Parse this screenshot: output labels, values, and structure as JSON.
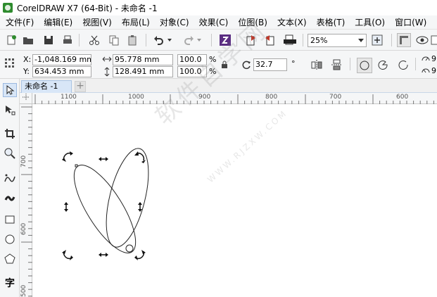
{
  "window": {
    "title": "CorelDRAW X7 (64-Bit) - 未命名 -1"
  },
  "menu": [
    "文件(F)",
    "编辑(E)",
    "视图(V)",
    "布局(L)",
    "对象(C)",
    "效果(C)",
    "位图(B)",
    "文本(X)",
    "表格(T)",
    "工具(O)",
    "窗口(W)"
  ],
  "toolbar": {
    "zoom_value": "25%",
    "icons": [
      "new-icon",
      "open-icon",
      "save-icon",
      "print-icon",
      "cut-icon",
      "copy-icon",
      "paste-icon",
      "undo-icon",
      "redo-icon",
      "search-content-icon",
      "import-icon",
      "export-icon",
      "publish-pdf-icon",
      "full-screen-icon",
      "show-rulers-icon",
      "view-icon"
    ]
  },
  "property_bar": {
    "x_label": "X:",
    "x_value": "-1,048.169 mm",
    "y_label": "Y:",
    "y_value": "634.453 mm",
    "width_value": "95.778 mm",
    "height_value": "128.491 mm",
    "scale_x": "100.0",
    "scale_y": "100.0",
    "percent": "%",
    "rotation": "32.7",
    "degree": "°",
    "right_value_1": "9",
    "right_value_2": "9"
  },
  "document_tabs": [
    {
      "label": "未命名 -1",
      "active": true
    }
  ],
  "add_tab_label": "+",
  "rulers": {
    "horizontal_ticks": [
      "1100",
      "1000",
      "900",
      "800",
      "700",
      "600"
    ],
    "vertical_ticks": [
      "700",
      "600",
      "500"
    ]
  },
  "toolbox": {
    "tools": [
      "pick-tool-icon",
      "shape-tool-icon",
      "crop-tool-icon",
      "zoom-tool-icon",
      "freehand-tool-icon",
      "artistic-media-icon",
      "rectangle-tool-icon",
      "ellipse-tool-icon",
      "polygon-tool-icon",
      "text-tool-icon"
    ],
    "text_tool_label": "字"
  },
  "watermark": {
    "main": "软件自学网",
    "sub": "WWW.RJZXW.COM"
  },
  "colors": {
    "accent": "#2e8b2e",
    "tab_active": "#d8e6f7",
    "chrome": "#f5f6f7"
  }
}
